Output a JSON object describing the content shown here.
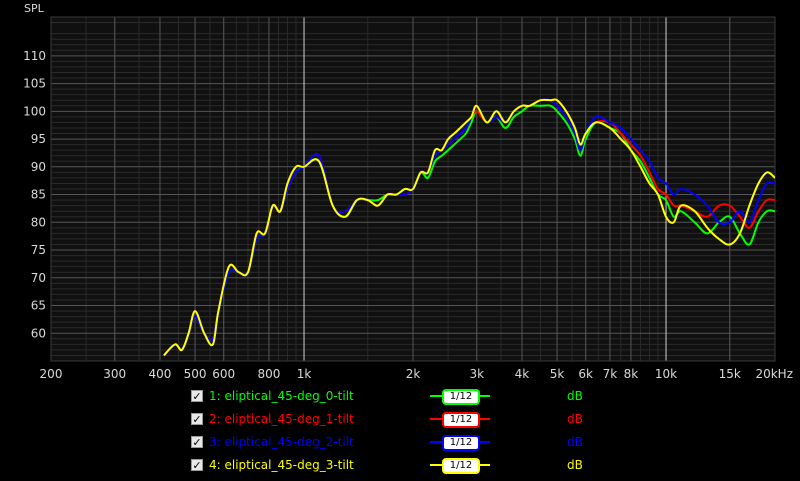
{
  "chart_data": {
    "type": "line",
    "ylabel": "SPL",
    "xscale": "log",
    "xlim": [
      200,
      20000
    ],
    "ylim": [
      55,
      117
    ],
    "x_ticks": [
      {
        "value": 200,
        "label": "200"
      },
      {
        "value": 300,
        "label": "300"
      },
      {
        "value": 400,
        "label": "400"
      },
      {
        "value": 500,
        "label": "500"
      },
      {
        "value": 600,
        "label": "600"
      },
      {
        "value": 800,
        "label": "800"
      },
      {
        "value": 1000,
        "label": "1k"
      },
      {
        "value": 2000,
        "label": "2k"
      },
      {
        "value": 3000,
        "label": "3k"
      },
      {
        "value": 4000,
        "label": "4k"
      },
      {
        "value": 5000,
        "label": "5k"
      },
      {
        "value": 6000,
        "label": "6k"
      },
      {
        "value": 7000,
        "label": "7k"
      },
      {
        "value": 8000,
        "label": "8k"
      },
      {
        "value": 10000,
        "label": "10k"
      },
      {
        "value": 15000,
        "label": "15k"
      },
      {
        "value": 20000,
        "label": "20kHz"
      }
    ],
    "y_ticks": [
      60,
      65,
      70,
      75,
      80,
      85,
      90,
      95,
      100,
      105,
      110
    ],
    "grid": true,
    "legend_position": "bottom",
    "x": [
      410,
      440,
      460,
      480,
      500,
      530,
      560,
      580,
      620,
      660,
      700,
      740,
      780,
      820,
      860,
      900,
      950,
      1000,
      1100,
      1200,
      1300,
      1400,
      1500,
      1600,
      1700,
      1800,
      1900,
      2000,
      2100,
      2200,
      2300,
      2400,
      2500,
      2600,
      2700,
      2800,
      2900,
      3000,
      3200,
      3400,
      3600,
      3800,
      4000,
      4200,
      4500,
      4800,
      5000,
      5300,
      5600,
      5800,
      6000,
      6400,
      7000,
      7500,
      8000,
      8500,
      9000,
      9500,
      10000,
      10500,
      11000,
      12000,
      13000,
      14000,
      15000,
      16000,
      17000,
      18000,
      19000,
      20000
    ],
    "series": [
      {
        "name": "1: eliptical_45-deg_0-tilt",
        "color": "#00ff00",
        "values": [
          56,
          58,
          57,
          60,
          63,
          60,
          59,
          64,
          71,
          71,
          71,
          77,
          78,
          83,
          82,
          86,
          89,
          90,
          91,
          83,
          81,
          84,
          84,
          84,
          85,
          85,
          86,
          86,
          89,
          88,
          91,
          92,
          93,
          94,
          95,
          96,
          98,
          100,
          98,
          99,
          97,
          99,
          100,
          101,
          101,
          101,
          100,
          98,
          95,
          92,
          95,
          98,
          97,
          96,
          93,
          91,
          88,
          85,
          84,
          81,
          82,
          80,
          78,
          80,
          81,
          78,
          76,
          80,
          82,
          82
        ]
      },
      {
        "name": "2: eliptical_45-deg_1-tilt",
        "color": "#ff0000",
        "values": [
          56,
          58,
          57,
          60,
          63,
          60,
          59,
          64,
          72,
          71,
          71,
          78,
          78,
          83,
          82,
          86,
          89,
          90,
          92,
          83,
          82,
          84,
          84,
          83,
          85,
          85,
          85,
          86,
          89,
          89,
          92,
          93,
          94,
          95,
          96,
          97,
          99,
          100,
          98,
          99,
          98,
          100,
          101,
          101,
          102,
          102,
          101,
          99,
          96,
          93,
          96,
          98,
          98,
          96,
          94,
          92,
          89,
          86,
          85,
          83,
          83,
          82,
          81,
          83,
          83,
          81,
          79,
          82,
          84,
          84
        ]
      },
      {
        "name": "3: eliptical_45-deg_2-tilt",
        "color": "#0000ff",
        "values": [
          56,
          58,
          57,
          60,
          63,
          60,
          59,
          64,
          71,
          71,
          71,
          77,
          78,
          83,
          82,
          86,
          89,
          90,
          92,
          83,
          82,
          84,
          84,
          83,
          85,
          85,
          85,
          86,
          89,
          89,
          92,
          93,
          94,
          95,
          96,
          97,
          99,
          101,
          98,
          99,
          98,
          100,
          101,
          101,
          102,
          102,
          101,
          99,
          96,
          93,
          96,
          99,
          98,
          97,
          95,
          93,
          91,
          88,
          87,
          85,
          86,
          85,
          83,
          80,
          80,
          82,
          80,
          84,
          87,
          87
        ]
      },
      {
        "name": "4: eliptical_45-deg_3-tilt",
        "color": "#ffff00",
        "values": [
          56,
          58,
          57,
          60,
          64,
          60,
          58,
          64,
          72,
          71,
          71,
          78,
          78,
          83,
          82,
          87,
          90,
          90,
          91,
          83,
          81,
          84,
          84,
          83,
          85,
          85,
          86,
          86,
          89,
          89,
          93,
          93,
          95,
          96,
          97,
          98,
          99,
          101,
          98,
          100,
          98,
          100,
          101,
          101,
          102,
          102,
          102,
          100,
          97,
          94,
          96,
          98,
          97,
          95,
          93,
          90,
          87,
          85,
          81,
          80,
          83,
          82,
          79,
          77,
          76,
          78,
          83,
          87,
          89,
          88
        ]
      }
    ]
  },
  "legend": {
    "items": [
      {
        "checked": "✓",
        "label": "1: eliptical_45-deg_0-tilt",
        "smoothing": "1/12",
        "unit": "dB"
      },
      {
        "checked": "✓",
        "label": "2: eliptical_45-deg_1-tilt",
        "smoothing": "1/12",
        "unit": "dB"
      },
      {
        "checked": "✓",
        "label": "3: eliptical_45-deg_2-tilt",
        "smoothing": "1/12",
        "unit": "dB"
      },
      {
        "checked": "✓",
        "label": "4: eliptical_45-deg_3-tilt",
        "smoothing": "1/12",
        "unit": "dB"
      }
    ]
  },
  "colors": {
    "background": "#000000",
    "plot_bg": "#101010",
    "grid_major": "#555555",
    "grid_minor": "#2a2a2a",
    "axis_text": "#d9d9d9",
    "marker_line": "#cfcfcf"
  }
}
